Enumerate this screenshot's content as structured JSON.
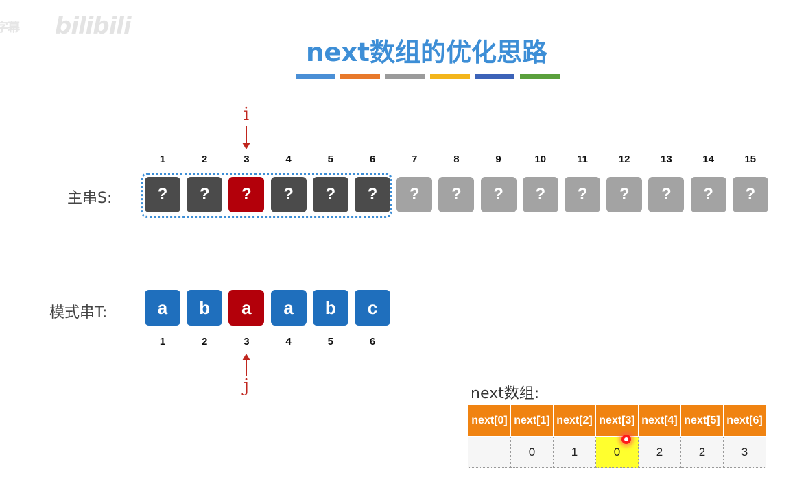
{
  "watermark": {
    "left_text": "字幕",
    "logo_text": "bilibili"
  },
  "title": "next数组的优化思路",
  "title_colors": [
    "#4a8fd6",
    "#e8792b",
    "#9b9b9b",
    "#f3b51b",
    "#3c63b8",
    "#5aa03c"
  ],
  "main_string": {
    "label": "主串S:",
    "indices": [
      "1",
      "2",
      "3",
      "4",
      "5",
      "6",
      "7",
      "8",
      "9",
      "10",
      "11",
      "12",
      "13",
      "14",
      "15"
    ],
    "cells": [
      {
        "text": "?",
        "state": "dark"
      },
      {
        "text": "?",
        "state": "dark"
      },
      {
        "text": "?",
        "state": "red"
      },
      {
        "text": "?",
        "state": "dark"
      },
      {
        "text": "?",
        "state": "dark"
      },
      {
        "text": "?",
        "state": "dark"
      },
      {
        "text": "?",
        "state": "light"
      },
      {
        "text": "?",
        "state": "light"
      },
      {
        "text": "?",
        "state": "light"
      },
      {
        "text": "?",
        "state": "light"
      },
      {
        "text": "?",
        "state": "light"
      },
      {
        "text": "?",
        "state": "light"
      },
      {
        "text": "?",
        "state": "light"
      },
      {
        "text": "?",
        "state": "light"
      },
      {
        "text": "?",
        "state": "light"
      }
    ],
    "pointer_label": "i"
  },
  "pattern_string": {
    "label": "模式串T:",
    "indices": [
      "1",
      "2",
      "3",
      "4",
      "5",
      "6"
    ],
    "cells": [
      {
        "text": "a",
        "state": "blue"
      },
      {
        "text": "b",
        "state": "blue"
      },
      {
        "text": "a",
        "state": "red"
      },
      {
        "text": "a",
        "state": "blue"
      },
      {
        "text": "b",
        "state": "blue"
      },
      {
        "text": "c",
        "state": "blue"
      }
    ],
    "pointer_label": "j"
  },
  "next_array": {
    "label": "next数组:",
    "headers": [
      "next[0]",
      "next[1]",
      "next[2]",
      "next[3]",
      "next[4]",
      "next[5]",
      "next[6]"
    ],
    "values": [
      "",
      "0",
      "1",
      "0",
      "2",
      "2",
      "3"
    ],
    "highlight_index": 3,
    "highlight_color": "#ffff2e",
    "header_color": "#f08311"
  }
}
